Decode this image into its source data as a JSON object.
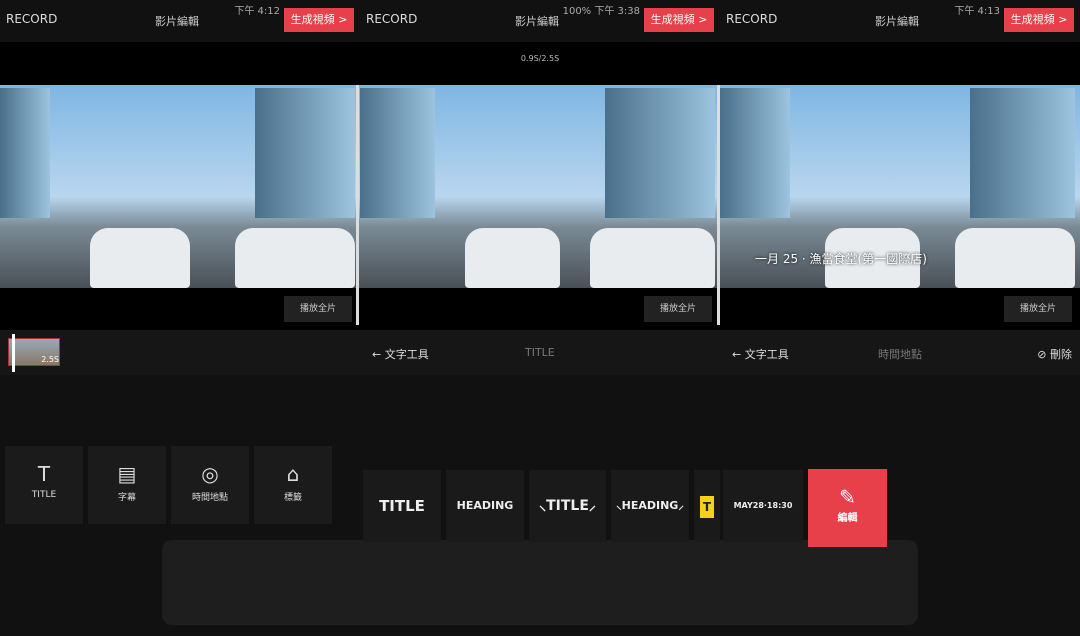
{
  "panels": [
    {
      "back": "RECORD",
      "title": "影片編輯",
      "status": "下午 4:12",
      "generate": "生成視頻 >",
      "play": "播放全片",
      "clip_duration": "2.5S"
    },
    {
      "back": "RECORD",
      "title": "影片編輯",
      "status": "100% 下午 3:38",
      "generate": "生成視頻 >",
      "timecode": "0.9S/2.5S",
      "play": "播放全片",
      "toolbar": {
        "back": "← 文字工具",
        "current": "TITLE"
      }
    },
    {
      "back": "RECORD",
      "title": "影片編輯",
      "status": "下午 4:13",
      "generate": "生成視頻 >",
      "play": "播放全片",
      "overlay_text": "一月 25 · 漁當食堂(第一國際店)",
      "toolbar": {
        "back": "← 文字工具",
        "current": "時間地點",
        "delete": "⊘ 刪除"
      }
    }
  ],
  "tools": [
    {
      "icon": "T",
      "label": "TITLE"
    },
    {
      "icon": "▤",
      "label": "字幕"
    },
    {
      "icon": "◎",
      "label": "時間地點"
    },
    {
      "icon": "⌂",
      "label": "標籤"
    }
  ],
  "styles": [
    "TITLE",
    "HEADING",
    "⸜TITLE⸝",
    "⸜HEADING⸝",
    "T",
    "MAY28·18:30"
  ],
  "edit": {
    "icon": "✎",
    "label": "編輯"
  },
  "colors": {
    "accent": "#e8404a",
    "tag_yellow": "#f2d21b"
  }
}
